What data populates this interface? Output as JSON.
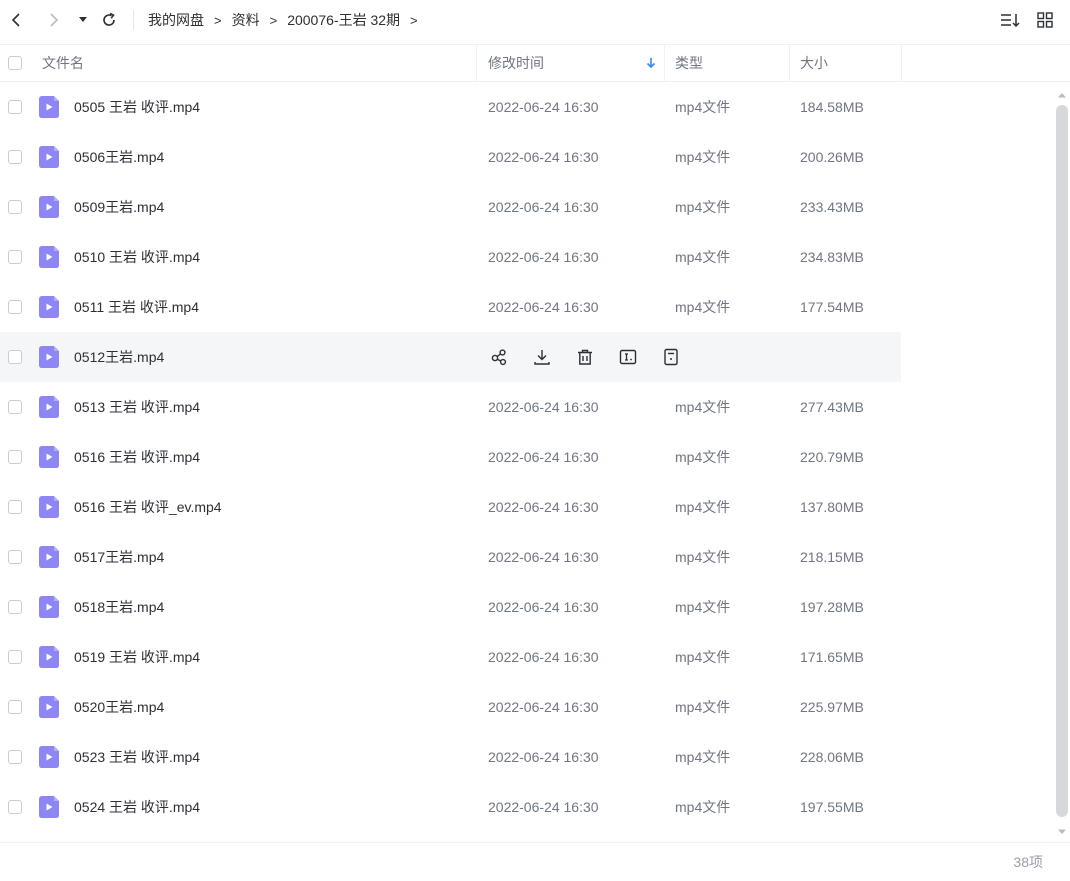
{
  "breadcrumb": [
    "我的网盘",
    "资料",
    "200076-王岩 32期"
  ],
  "breadcrumb_separator": ">",
  "columns": {
    "name": "文件名",
    "modified": "修改时间",
    "type": "类型",
    "size": "大小"
  },
  "icons": {
    "back": "chevron-left-icon",
    "forward": "chevron-right-icon",
    "history": "caret-down-icon",
    "refresh": "refresh-icon",
    "sort": "sort-list-icon",
    "grid": "grid-view-icon",
    "file": "video-file-icon",
    "sort_indicator": "arrow-down-icon",
    "row_actions": [
      "share-icon",
      "download-icon",
      "delete-icon",
      "rename-icon",
      "more-icon"
    ]
  },
  "colors": {
    "file_icon": "#8f86f5",
    "sort_arrow": "#3b86f5",
    "hover_row": "#f5f6f8"
  },
  "files": [
    {
      "name": "0505 王岩 收评.mp4",
      "modified": "2022-06-24 16:30",
      "type": "mp4文件",
      "size": "184.58MB"
    },
    {
      "name": "0506王岩.mp4",
      "modified": "2022-06-24 16:30",
      "type": "mp4文件",
      "size": "200.26MB"
    },
    {
      "name": "0509王岩.mp4",
      "modified": "2022-06-24 16:30",
      "type": "mp4文件",
      "size": "233.43MB"
    },
    {
      "name": "0510 王岩 收评.mp4",
      "modified": "2022-06-24 16:30",
      "type": "mp4文件",
      "size": "234.83MB"
    },
    {
      "name": "0511 王岩 收评.mp4",
      "modified": "2022-06-24 16:30",
      "type": "mp4文件",
      "size": "177.54MB"
    },
    {
      "name": "0512王岩.mp4",
      "modified": "",
      "type": "",
      "size": "",
      "hover": true
    },
    {
      "name": "0513 王岩 收评.mp4",
      "modified": "2022-06-24 16:30",
      "type": "mp4文件",
      "size": "277.43MB"
    },
    {
      "name": "0516 王岩 收评.mp4",
      "modified": "2022-06-24 16:30",
      "type": "mp4文件",
      "size": "220.79MB"
    },
    {
      "name": "0516 王岩 收评_ev.mp4",
      "modified": "2022-06-24 16:30",
      "type": "mp4文件",
      "size": "137.80MB"
    },
    {
      "name": "0517王岩.mp4",
      "modified": "2022-06-24 16:30",
      "type": "mp4文件",
      "size": "218.15MB"
    },
    {
      "name": "0518王岩.mp4",
      "modified": "2022-06-24 16:30",
      "type": "mp4文件",
      "size": "197.28MB"
    },
    {
      "name": "0519 王岩 收评.mp4",
      "modified": "2022-06-24 16:30",
      "type": "mp4文件",
      "size": "171.65MB"
    },
    {
      "name": "0520王岩.mp4",
      "modified": "2022-06-24 16:30",
      "type": "mp4文件",
      "size": "225.97MB"
    },
    {
      "name": "0523 王岩 收评.mp4",
      "modified": "2022-06-24 16:30",
      "type": "mp4文件",
      "size": "228.06MB"
    },
    {
      "name": "0524 王岩 收评.mp4",
      "modified": "2022-06-24 16:30",
      "type": "mp4文件",
      "size": "197.55MB"
    }
  ],
  "item_count": "38项"
}
